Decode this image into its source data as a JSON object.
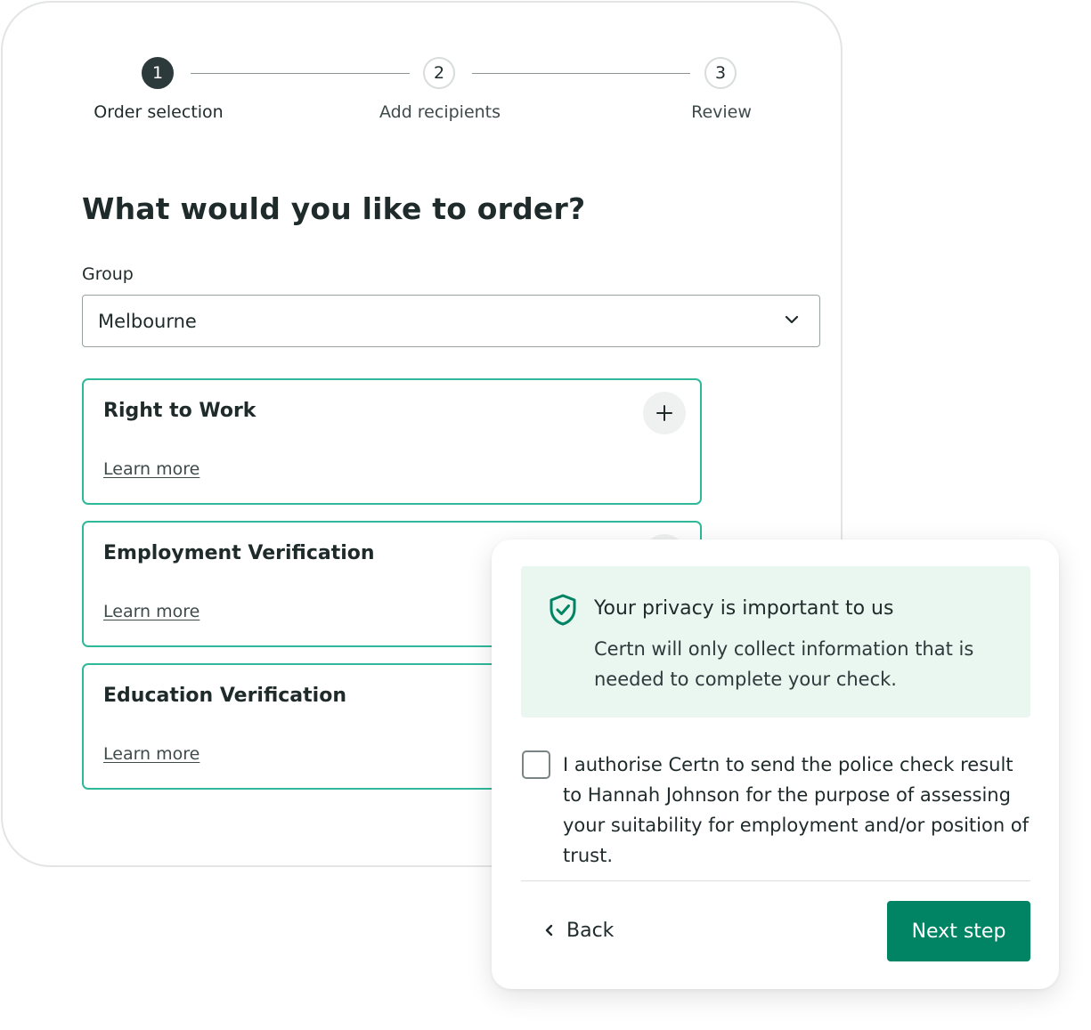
{
  "stepper": {
    "steps": [
      {
        "number": "1",
        "label": "Order selection"
      },
      {
        "number": "2",
        "label": "Add recipients"
      },
      {
        "number": "3",
        "label": "Review"
      }
    ]
  },
  "page": {
    "title": "What would you like to order?"
  },
  "group": {
    "label": "Group",
    "value": "Melbourne"
  },
  "products": [
    {
      "title": "Right to Work",
      "link": "Learn more"
    },
    {
      "title": "Employment Verification",
      "link": "Learn more"
    },
    {
      "title": "Education Verification",
      "link": "Learn more"
    }
  ],
  "privacy": {
    "title": "Your privacy is important to us",
    "text": "Certn will only collect information that is needed to complete your check."
  },
  "consent": {
    "text": "I authorise Certn to send the police check result to Hannah Johnson for the purpose of assessing your suitability for employment and/or position of trust."
  },
  "footer": {
    "back_label": "Back",
    "next_label": "Next step"
  },
  "colors": {
    "accent": "#008463",
    "card_border": "#2fb89a",
    "privacy_bg": "#eaf6f0",
    "step_active": "#2d3a3b"
  }
}
